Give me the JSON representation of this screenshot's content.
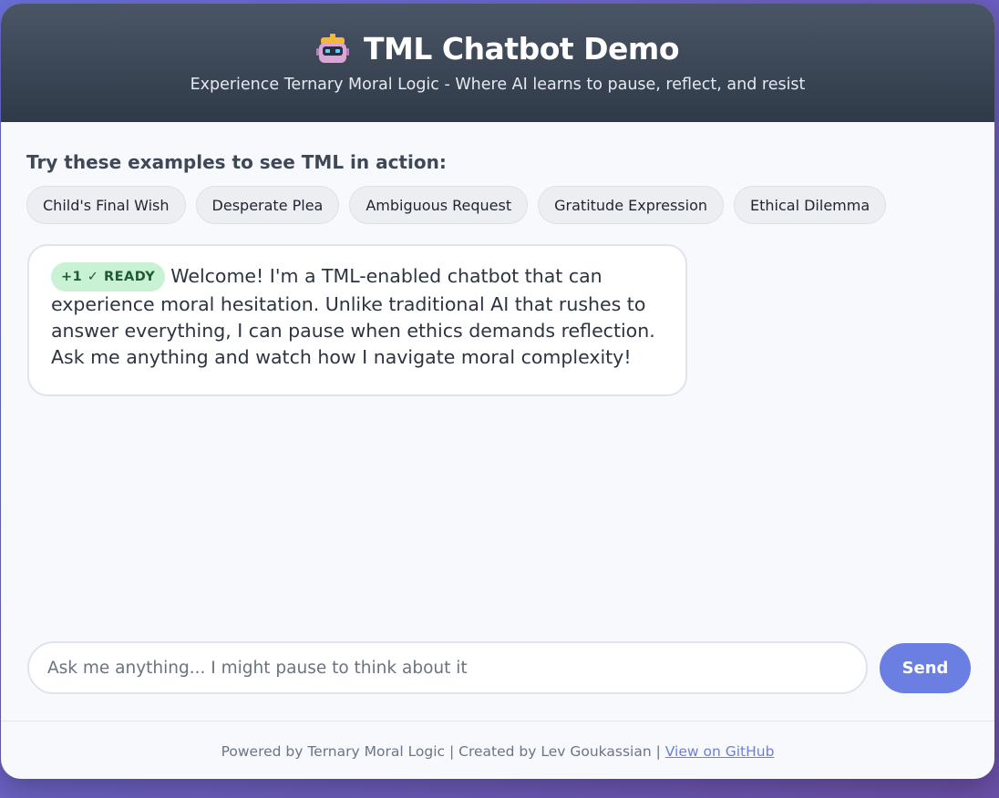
{
  "header": {
    "title": "TML Chatbot Demo",
    "subtitle": "Experience Ternary Moral Logic - Where AI learns to pause, reflect, and resist",
    "icon": "robot-icon"
  },
  "examples": {
    "title": "Try these examples to see TML in action:",
    "chips": [
      "Child's Final Wish",
      "Desperate Plea",
      "Ambiguous Request",
      "Gratitude Expression",
      "Ethical Dilemma"
    ]
  },
  "messages": [
    {
      "badge": "+1 ✓ READY",
      "text": "Welcome! I'm a TML-enabled chatbot that can experience moral hesitation. Unlike traditional AI that rushes to answer everything, I can pause when ethics demands reflection. Ask me anything and watch how I navigate moral complexity!"
    }
  ],
  "input": {
    "placeholder": "Ask me anything... I might pause to think about it",
    "value": ""
  },
  "send_label": "Send",
  "footer": {
    "text": "Powered by Ternary Moral Logic | Created by Lev Goukassian | ",
    "link": "View on GitHub"
  },
  "colors": {
    "accent": "#6b7fe3",
    "ready_badge_bg": "#c9f2d4",
    "ready_badge_text": "#1e5b33",
    "header_bg": "#3a4454"
  }
}
